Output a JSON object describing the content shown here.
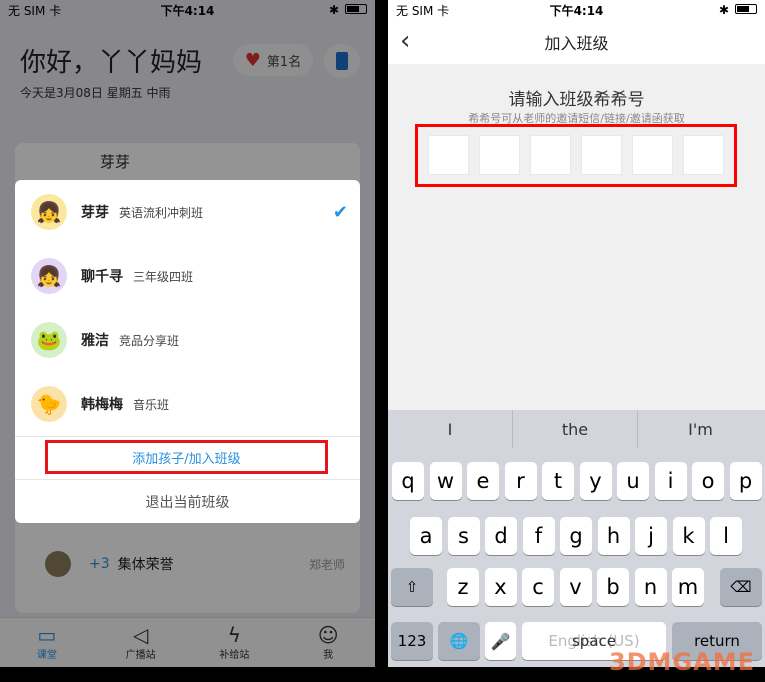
{
  "left": {
    "status": {
      "carrier": "无 SIM 卡",
      "time": "下午4:14"
    },
    "greeting": "你好，丫丫妈妈",
    "date": "今天是3月08日 星期五 中雨",
    "rank": "第1名",
    "child_name": "芽芽",
    "children": [
      {
        "name": "芽芽",
        "class": "英语流利冲刺班",
        "selected": true,
        "avatar": "👧"
      },
      {
        "name": "聊千寻",
        "class": "三年级四班",
        "selected": false,
        "avatar": "👧"
      },
      {
        "name": "雅洁",
        "class": "竞品分享班",
        "selected": false,
        "avatar": "🐸"
      },
      {
        "name": "韩梅梅",
        "class": "音乐班",
        "selected": false,
        "avatar": "🐤"
      }
    ],
    "add_label": "添加孩子/加入班级",
    "quit_label": "退出当前班级",
    "feed": {
      "count": "+3",
      "title": "集体荣誉",
      "teacher": "郑老师"
    },
    "tabs": [
      {
        "label": "课堂",
        "active": true
      },
      {
        "label": "广播站"
      },
      {
        "label": "补给站"
      },
      {
        "label": "我"
      }
    ],
    "accent": "#2a90e0"
  },
  "right": {
    "status": {
      "carrier": "无 SIM 卡",
      "time": "下午4:14"
    },
    "title": "加入班级",
    "prompt": "请输入班级希希号",
    "hint": "希希号可从老师的邀请短信/链接/邀请函获取",
    "code_cells": [
      "",
      "",
      "",
      "",
      "",
      ""
    ],
    "suggestions": [
      "I",
      "the",
      "I'm"
    ],
    "rows": [
      [
        "q",
        "w",
        "e",
        "r",
        "t",
        "y",
        "u",
        "i",
        "o",
        "p"
      ],
      [
        "a",
        "s",
        "d",
        "f",
        "g",
        "h",
        "j",
        "k",
        "l"
      ],
      [
        "z",
        "x",
        "c",
        "v",
        "b",
        "n",
        "m"
      ]
    ],
    "keys": {
      "numbers": "123",
      "space": "space",
      "space_hint": "English (US)",
      "return": "return"
    }
  },
  "watermark": "3DMGAME"
}
